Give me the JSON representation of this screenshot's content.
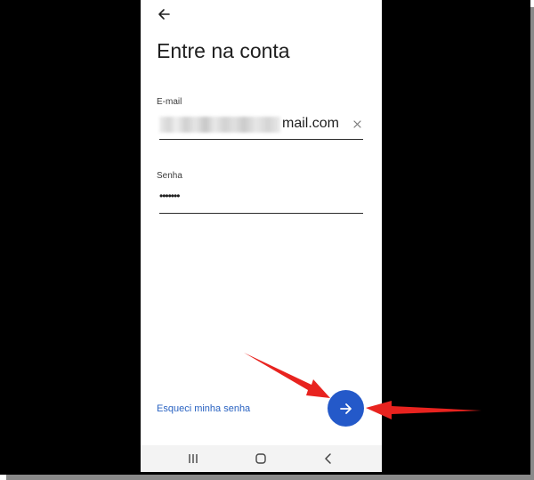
{
  "screen": {
    "title": "Entre na conta",
    "email": {
      "label": "E-mail",
      "value_visible": "mail.com",
      "obscured_prefix": true
    },
    "password": {
      "label": "Senha",
      "value": "•••••••"
    },
    "forgot_password_link": "Esqueci minha senha",
    "next_button_icon": "arrow-right-icon",
    "accent_color": "#2459c9",
    "link_color": "#2a63c2"
  },
  "nav_bar": {
    "icons": [
      "recent-apps-icon",
      "home-icon",
      "back-icon"
    ]
  },
  "annotations": {
    "arrow_color": "#e8231f",
    "count": 2
  }
}
